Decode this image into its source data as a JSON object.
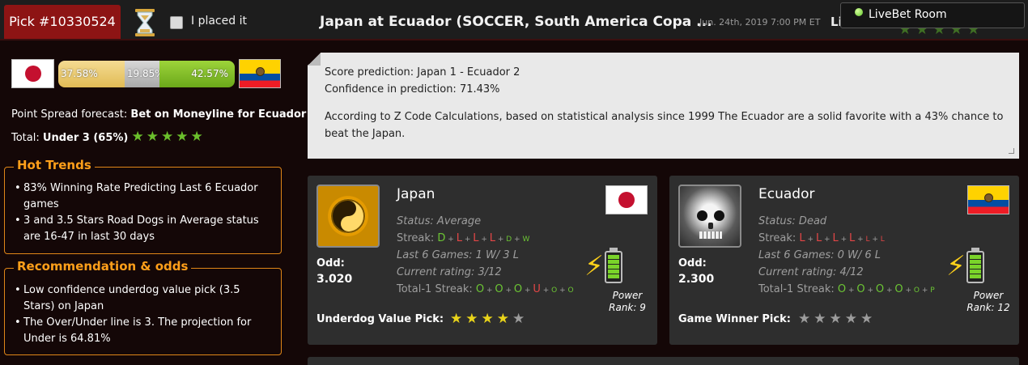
{
  "header": {
    "pick_label": "Pick #10330524",
    "placed_label": "I placed it",
    "match_title": "Japan at Ecuador (SOCCER, South America Copa ...",
    "match_date": "Jun. 24th, 2019 7:00 PM ET",
    "truncated_label": "Li",
    "livebet_label": "LiveBet Room"
  },
  "odds_bar": {
    "home_pct": "37.58%",
    "draw_pct": "19.85%",
    "away_pct": "42.57%"
  },
  "forecast": {
    "point_spread_label": "Point Spread forecast:",
    "point_spread_value": "Bet on Moneyline for Ecuador",
    "total_label": "Total:",
    "total_value": "Under 3 (65%)",
    "total_stars": 5
  },
  "hot_trends": {
    "title": "Hot Trends",
    "items": [
      "83% Winning Rate Predicting Last 6 Ecuador games",
      "3 and 3.5 Stars Road Dogs in Average status are 16-47 in last 30 days"
    ]
  },
  "recommendation": {
    "title": "Recommendation & odds",
    "items": [
      "Low confidence underdog value pick (3.5 Stars) on Japan",
      "The Over/Under line is 3. The projection for Under is 64.81%"
    ]
  },
  "prediction": {
    "score": "Score prediction: Japan 1 - Ecuador 2",
    "confidence": "Confidence in prediction: 71.43%",
    "analysis": "According to Z Code Calculations, based on statistical analysis since 1999 The Ecuador are a solid favorite with a 43% chance to beat the Japan."
  },
  "teams": [
    {
      "name": "Japan",
      "logo_icon": "yin-yang-icon",
      "status": "Status: Average",
      "streak_label": "Streak:",
      "streak": [
        "D",
        "L",
        "L",
        "L",
        "D",
        "W"
      ],
      "last6": "Last 6 Games: 1 W/ 3 L",
      "rating": "Current rating: 3/12",
      "total_streak_label": "Total-1 Streak:",
      "total_streak": [
        "O",
        "O",
        "O",
        "U",
        "O",
        "O"
      ],
      "odd_label": "Odd:",
      "odd_value": "3.020",
      "power_label": "Power",
      "power_rank": "Rank: 9",
      "pick_label": "Underdog Value Pick:",
      "pick_stars_filled": 4,
      "pick_stars_total": 5,
      "star_color": "#e9d41a"
    },
    {
      "name": "Ecuador",
      "logo_icon": "skull-icon",
      "status": "Status: Dead",
      "streak_label": "Streak:",
      "streak": [
        "L",
        "L",
        "L",
        "L",
        "L",
        "L"
      ],
      "last6": "Last 6 Games: 0 W/ 6 L",
      "rating": "Current rating: 4/12",
      "total_streak_label": "Total-1 Streak:",
      "total_streak": [
        "O",
        "O",
        "O",
        "O",
        "O",
        "P"
      ],
      "odd_label": "Odd:",
      "odd_value": "2.300",
      "power_label": "Power",
      "power_rank": "Rank: 12",
      "pick_label": "Game Winner Pick:",
      "pick_stars_filled": 0,
      "pick_stars_total": 5,
      "star_color": "#9c9c9c"
    }
  ],
  "colors": {
    "accent": "#ff9f1a",
    "pick_tab": "#8d1414",
    "win": "#6cc534",
    "loss": "#e24646"
  }
}
